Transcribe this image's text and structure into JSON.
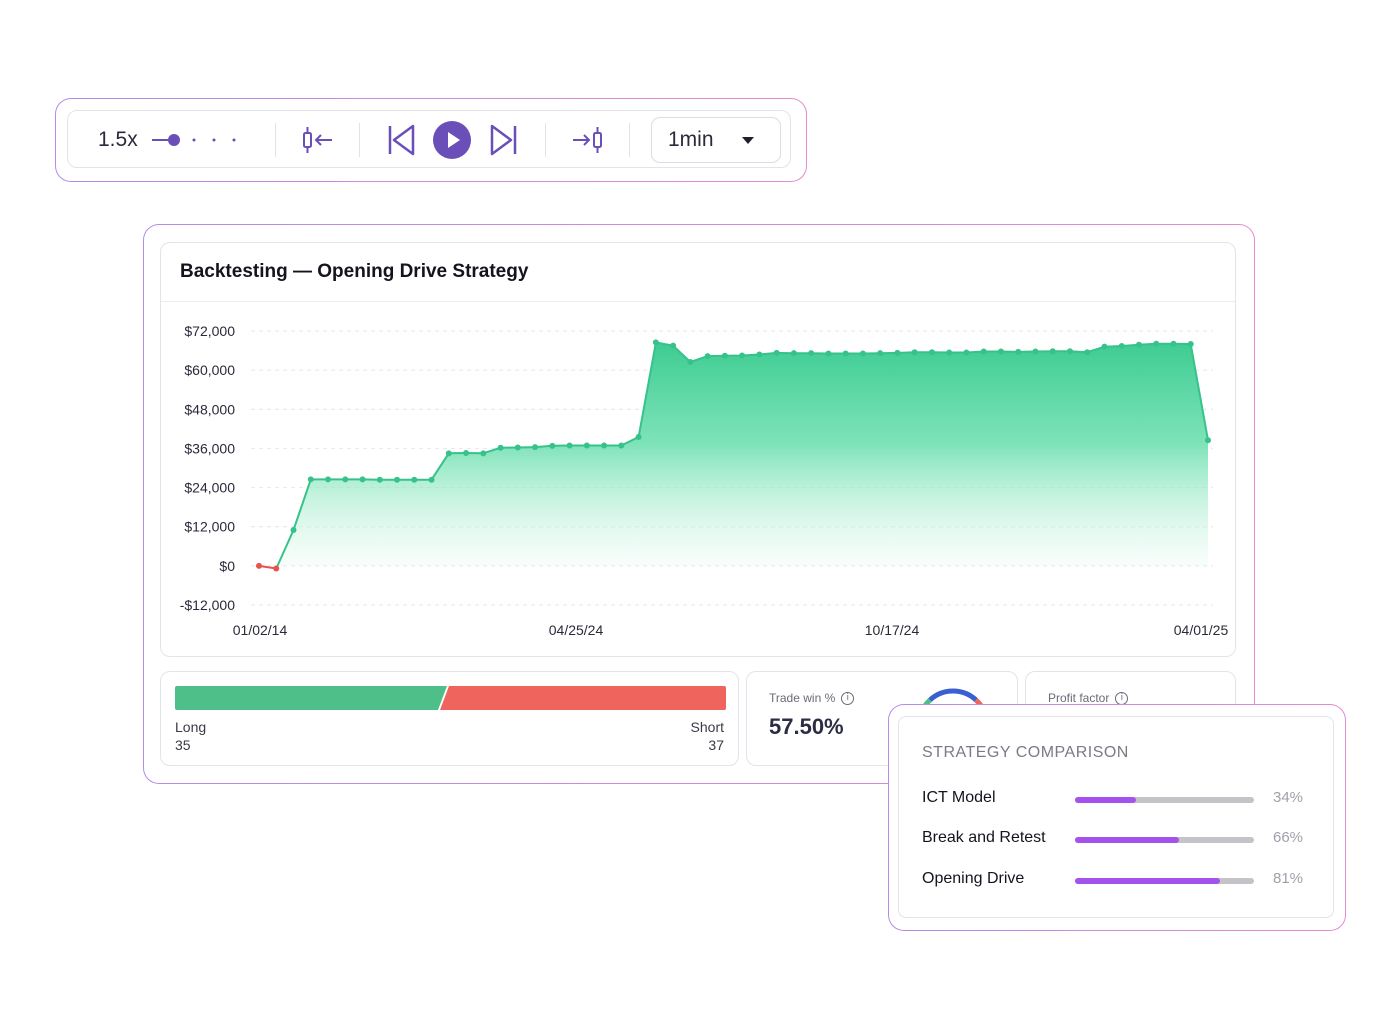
{
  "toolbar": {
    "speed_label": "1.5x",
    "speed_level": 0.25,
    "icons": [
      "collapse-left-icon",
      "skip-back-icon",
      "play-icon",
      "skip-forward-icon",
      "expand-right-icon"
    ],
    "timeframe_value": "1min",
    "accent_color": "#6a4fb8"
  },
  "main": {
    "title": "Backtesting — Opening Drive Strategy",
    "long": {
      "label": "Long",
      "count": "35"
    },
    "short": {
      "label": "Short",
      "count": "37"
    },
    "long_color": "#4fbf8a",
    "short_color": "#f0645e",
    "trade_win": {
      "label": "Trade win %",
      "value": "57.50%"
    },
    "profit_factor": {
      "label": "Profit factor"
    }
  },
  "chart_data": {
    "type": "area",
    "title": "Backtesting — Opening Drive Strategy",
    "xlabel": "",
    "ylabel": "",
    "ylim": [
      -12000,
      72000
    ],
    "y_ticks": [
      "$72,000",
      "$60,000",
      "$48,000",
      "$36,000",
      "$24,000",
      "$12,000",
      "$0",
      "-$12,000"
    ],
    "y_tick_values": [
      72000,
      60000,
      48000,
      36000,
      24000,
      12000,
      0,
      -12000
    ],
    "x_ticks": [
      "01/02/14",
      "04/25/24",
      "10/17/24",
      "04/01/25"
    ],
    "grid": true,
    "series": [
      {
        "color": "#37c28c",
        "negative_color": "#e8524c",
        "points": [
          [
            0,
            0
          ],
          [
            1,
            -800
          ],
          [
            2,
            11000
          ],
          [
            3,
            26500
          ],
          [
            4,
            26500
          ],
          [
            5,
            26500
          ],
          [
            6,
            26500
          ],
          [
            7,
            26400
          ],
          [
            8,
            26400
          ],
          [
            9,
            26400
          ],
          [
            10,
            26400
          ],
          [
            11,
            34500
          ],
          [
            12,
            34600
          ],
          [
            13,
            34500
          ],
          [
            14,
            36200
          ],
          [
            15,
            36300
          ],
          [
            16,
            36400
          ],
          [
            17,
            36800
          ],
          [
            18,
            36900
          ],
          [
            19,
            36900
          ],
          [
            20,
            36900
          ],
          [
            21,
            36900
          ],
          [
            22,
            39500
          ],
          [
            23,
            68500
          ],
          [
            24,
            67500
          ],
          [
            25,
            62500
          ],
          [
            26,
            64300
          ],
          [
            27,
            64400
          ],
          [
            28,
            64500
          ],
          [
            29,
            64800
          ],
          [
            30,
            65300
          ],
          [
            31,
            65200
          ],
          [
            32,
            65200
          ],
          [
            33,
            65100
          ],
          [
            34,
            65100
          ],
          [
            35,
            65100
          ],
          [
            36,
            65200
          ],
          [
            37,
            65300
          ],
          [
            38,
            65500
          ],
          [
            39,
            65500
          ],
          [
            40,
            65400
          ],
          [
            41,
            65400
          ],
          [
            42,
            65700
          ],
          [
            43,
            65700
          ],
          [
            44,
            65600
          ],
          [
            45,
            65700
          ],
          [
            46,
            65800
          ],
          [
            47,
            65800
          ],
          [
            48,
            65500
          ],
          [
            49,
            67200
          ],
          [
            50,
            67400
          ],
          [
            51,
            67800
          ],
          [
            52,
            68100
          ],
          [
            53,
            68100
          ],
          [
            54,
            68000
          ],
          [
            55,
            38500
          ]
        ]
      }
    ]
  },
  "comparison": {
    "title": "STRATEGY COMPARISON",
    "items": [
      {
        "name": "ICT Model",
        "pct_label": "34%",
        "value": 0.34
      },
      {
        "name": "Break and Retest",
        "pct_label": "66%",
        "value": 0.58
      },
      {
        "name": "Opening Drive",
        "pct_label": "81%",
        "value": 0.81
      }
    ]
  }
}
